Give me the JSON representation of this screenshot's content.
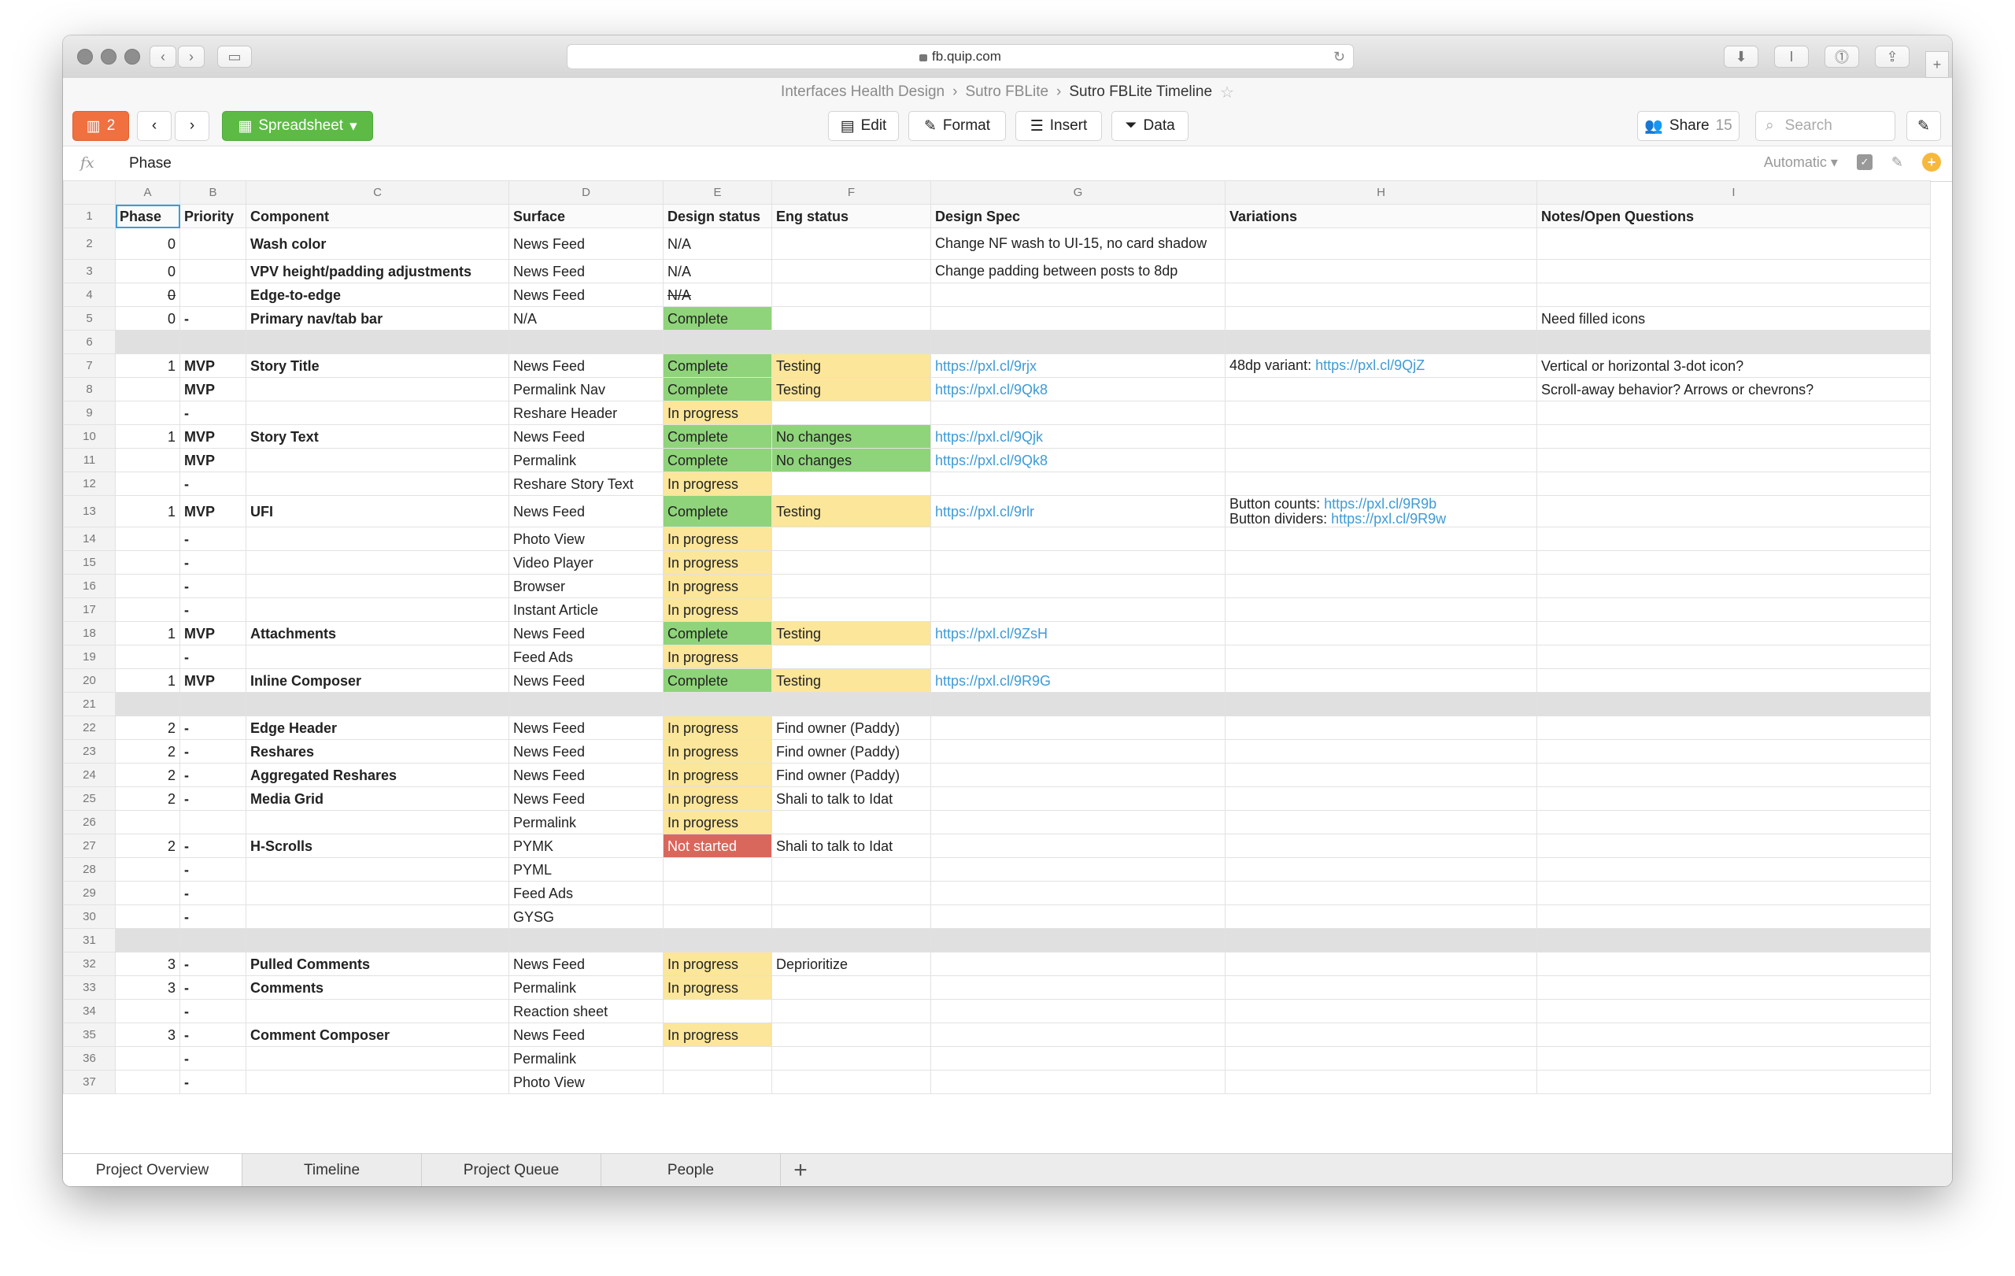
{
  "browser": {
    "url": "fb.quip.com"
  },
  "breadcrumb": {
    "items": [
      "Interfaces Health Design",
      "Sutro FBLite"
    ],
    "current": "Sutro FBLite Timeline"
  },
  "toolbar": {
    "sidebar_count": "2",
    "spreadsheet_label": "Spreadsheet",
    "edit_label": "Edit",
    "format_label": "Format",
    "insert_label": "Insert",
    "data_label": "Data",
    "share_label": "Share",
    "share_count": "15",
    "search_placeholder": "Search"
  },
  "formula_bar": {
    "fx": "fx",
    "value": "Phase",
    "format": "Automatic"
  },
  "columns": [
    "A",
    "B",
    "C",
    "D",
    "E",
    "F",
    "G",
    "H",
    "I"
  ],
  "header_row": [
    "Phase",
    "Priority",
    "Component",
    "Surface",
    "Design status",
    "Eng status",
    "Design Spec",
    "Variations",
    "Notes/Open Questions"
  ],
  "rows": [
    {
      "n": "2",
      "phase": "0",
      "priority": "",
      "component": "Wash color",
      "surface": "News Feed",
      "design": "N/A",
      "eng": "",
      "spec": "Change NF wash to UI-15, no card shadow",
      "var": "",
      "var_link": "",
      "var2": "",
      "var2_link": "",
      "notes": ""
    },
    {
      "n": "3",
      "phase": "0",
      "priority": "",
      "component": "VPV height/padding adjustments",
      "surface": "News Feed",
      "design": "N/A",
      "eng": "",
      "spec": "Change padding between posts to 8dp",
      "var": "",
      "var_link": "",
      "var2": "",
      "var2_link": "",
      "notes": ""
    },
    {
      "n": "4",
      "phase": "0",
      "priority": "",
      "component": "Edge-to-edge",
      "surface": "News Feed",
      "design": "N/A",
      "eng": "",
      "spec": "",
      "var": "",
      "var_link": "",
      "var2": "",
      "var2_link": "",
      "notes": ""
    },
    {
      "n": "5",
      "phase": "0",
      "priority": "-",
      "component": "Primary nav/tab bar",
      "surface": "N/A",
      "design": "Complete",
      "eng": "",
      "spec": "",
      "var": "",
      "var_link": "",
      "var2": "",
      "var2_link": "",
      "notes": "Need filled icons"
    },
    {
      "n": "6",
      "sep": true
    },
    {
      "n": "7",
      "phase": "1",
      "priority": "MVP",
      "component": "Story Title",
      "surface": "News Feed",
      "design": "Complete",
      "eng": "Testing",
      "spec": "https://pxl.cl/9rjx",
      "var": "48dp variant: ",
      "var_link": "https://pxl.cl/9QjZ",
      "var2": "",
      "var2_link": "",
      "notes": "Vertical or horizontal 3-dot icon?"
    },
    {
      "n": "8",
      "phase": "",
      "priority": "MVP",
      "component": "",
      "surface": "Permalink Nav",
      "design": "Complete",
      "eng": "Testing",
      "spec": "https://pxl.cl/9Qk8",
      "var": "",
      "var_link": "",
      "var2": "",
      "var2_link": "",
      "notes": "Scroll-away behavior? Arrows or chevrons?"
    },
    {
      "n": "9",
      "phase": "",
      "priority": "-",
      "component": "",
      "surface": "Reshare Header",
      "design": "In progress",
      "eng": "",
      "spec": "",
      "var": "",
      "var_link": "",
      "var2": "",
      "var2_link": "",
      "notes": ""
    },
    {
      "n": "10",
      "phase": "1",
      "priority": "MVP",
      "component": "Story Text",
      "surface": "News Feed",
      "design": "Complete",
      "eng": "No changes",
      "spec": "https://pxl.cl/9Qjk",
      "var": "",
      "var_link": "",
      "var2": "",
      "var2_link": "",
      "notes": ""
    },
    {
      "n": "11",
      "phase": "",
      "priority": "MVP",
      "component": "",
      "surface": "Permalink",
      "design": "Complete",
      "eng": "No changes",
      "spec": "https://pxl.cl/9Qk8",
      "var": "",
      "var_link": "",
      "var2": "",
      "var2_link": "",
      "notes": ""
    },
    {
      "n": "12",
      "phase": "",
      "priority": "-",
      "component": "",
      "surface": "Reshare Story Text",
      "design": "In progress",
      "eng": "",
      "spec": "",
      "var": "",
      "var_link": "",
      "var2": "",
      "var2_link": "",
      "notes": ""
    },
    {
      "n": "13",
      "phase": "1",
      "priority": "MVP",
      "component": "UFI",
      "surface": "News Feed",
      "design": "Complete",
      "eng": "Testing",
      "spec": "https://pxl.cl/9rlr",
      "var": "Button counts: ",
      "var_link": "https://pxl.cl/9R9b",
      "var2": "Button dividers: ",
      "var2_link": "https://pxl.cl/9R9w",
      "notes": ""
    },
    {
      "n": "14",
      "phase": "",
      "priority": "-",
      "component": "",
      "surface": "Photo View",
      "design": "In progress",
      "eng": "",
      "spec": "",
      "var": "",
      "var_link": "",
      "var2": "",
      "var2_link": "",
      "notes": ""
    },
    {
      "n": "15",
      "phase": "",
      "priority": "-",
      "component": "",
      "surface": "Video Player",
      "design": "In progress",
      "eng": "",
      "spec": "",
      "var": "",
      "var_link": "",
      "var2": "",
      "var2_link": "",
      "notes": ""
    },
    {
      "n": "16",
      "phase": "",
      "priority": "-",
      "component": "",
      "surface": "Browser",
      "design": "In progress",
      "eng": "",
      "spec": "",
      "var": "",
      "var_link": "",
      "var2": "",
      "var2_link": "",
      "notes": ""
    },
    {
      "n": "17",
      "phase": "",
      "priority": "-",
      "component": "",
      "surface": "Instant Article",
      "design": "In progress",
      "eng": "",
      "spec": "",
      "var": "",
      "var_link": "",
      "var2": "",
      "var2_link": "",
      "notes": ""
    },
    {
      "n": "18",
      "phase": "1",
      "priority": "MVP",
      "component": "Attachments",
      "surface": "News Feed",
      "design": "Complete",
      "eng": "Testing",
      "spec": "https://pxl.cl/9ZsH",
      "var": "",
      "var_link": "",
      "var2": "",
      "var2_link": "",
      "notes": ""
    },
    {
      "n": "19",
      "phase": "",
      "priority": "-",
      "component": "",
      "surface": "Feed Ads",
      "design": "In progress",
      "eng": "",
      "spec": "",
      "var": "",
      "var_link": "",
      "var2": "",
      "var2_link": "",
      "notes": ""
    },
    {
      "n": "20",
      "phase": "1",
      "priority": "MVP",
      "component": "Inline Composer",
      "surface": "News Feed",
      "design": "Complete",
      "eng": "Testing",
      "spec": "https://pxl.cl/9R9G",
      "var": "",
      "var_link": "",
      "var2": "",
      "var2_link": "",
      "notes": ""
    },
    {
      "n": "21",
      "sep": true
    },
    {
      "n": "22",
      "phase": "2",
      "priority": "-",
      "component": "Edge Header",
      "surface": "News Feed",
      "design": "In progress",
      "eng": "Find owner (Paddy)",
      "spec": "",
      "var": "",
      "var_link": "",
      "var2": "",
      "var2_link": "",
      "notes": ""
    },
    {
      "n": "23",
      "phase": "2",
      "priority": "-",
      "component": "Reshares",
      "surface": "News Feed",
      "design": "In progress",
      "eng": "Find owner (Paddy)",
      "spec": "",
      "var": "",
      "var_link": "",
      "var2": "",
      "var2_link": "",
      "notes": ""
    },
    {
      "n": "24",
      "phase": "2",
      "priority": "-",
      "component": "Aggregated Reshares",
      "surface": "News Feed",
      "design": "In progress",
      "eng": "Find owner (Paddy)",
      "spec": "",
      "var": "",
      "var_link": "",
      "var2": "",
      "var2_link": "",
      "notes": ""
    },
    {
      "n": "25",
      "phase": "2",
      "priority": "-",
      "component": "Media Grid",
      "surface": "News Feed",
      "design": "In progress",
      "eng": "Shali to talk to Idat",
      "spec": "",
      "var": "",
      "var_link": "",
      "var2": "",
      "var2_link": "",
      "notes": ""
    },
    {
      "n": "26",
      "phase": "",
      "priority": "",
      "component": "",
      "surface": "Permalink",
      "design": "In progress",
      "eng": "",
      "spec": "",
      "var": "",
      "var_link": "",
      "var2": "",
      "var2_link": "",
      "notes": ""
    },
    {
      "n": "27",
      "phase": "2",
      "priority": "-",
      "component": "H-Scrolls",
      "surface": "PYMK",
      "design": "Not started",
      "eng": "Shali to talk to Idat",
      "spec": "",
      "var": "",
      "var_link": "",
      "var2": "",
      "var2_link": "",
      "notes": ""
    },
    {
      "n": "28",
      "phase": "",
      "priority": "-",
      "component": "",
      "surface": "PYML",
      "design": "",
      "eng": "",
      "spec": "",
      "var": "",
      "var_link": "",
      "var2": "",
      "var2_link": "",
      "notes": ""
    },
    {
      "n": "29",
      "phase": "",
      "priority": "-",
      "component": "",
      "surface": "Feed Ads",
      "design": "",
      "eng": "",
      "spec": "",
      "var": "",
      "var_link": "",
      "var2": "",
      "var2_link": "",
      "notes": ""
    },
    {
      "n": "30",
      "phase": "",
      "priority": "-",
      "component": "",
      "surface": "GYSG",
      "design": "",
      "eng": "",
      "spec": "",
      "var": "",
      "var_link": "",
      "var2": "",
      "var2_link": "",
      "notes": ""
    },
    {
      "n": "31",
      "sep": true
    },
    {
      "n": "32",
      "phase": "3",
      "priority": "-",
      "component": "Pulled Comments",
      "surface": "News Feed",
      "design": "In progress",
      "eng": "Deprioritize",
      "spec": "",
      "var": "",
      "var_link": "",
      "var2": "",
      "var2_link": "",
      "notes": ""
    },
    {
      "n": "33",
      "phase": "3",
      "priority": "-",
      "component": "Comments",
      "surface": "Permalink",
      "design": "In progress",
      "eng": "",
      "spec": "",
      "var": "",
      "var_link": "",
      "var2": "",
      "var2_link": "",
      "notes": ""
    },
    {
      "n": "34",
      "phase": "",
      "priority": "-",
      "component": "",
      "surface": "Reaction sheet",
      "design": "",
      "eng": "",
      "spec": "",
      "var": "",
      "var_link": "",
      "var2": "",
      "var2_link": "",
      "notes": ""
    },
    {
      "n": "35",
      "phase": "3",
      "priority": "-",
      "component": "Comment Composer",
      "surface": "News Feed",
      "design": "In progress",
      "eng": "",
      "spec": "",
      "var": "",
      "var_link": "",
      "var2": "",
      "var2_link": "",
      "notes": ""
    },
    {
      "n": "36",
      "phase": "",
      "priority": "-",
      "component": "",
      "surface": "Permalink",
      "design": "",
      "eng": "",
      "spec": "",
      "var": "",
      "var_link": "",
      "var2": "",
      "var2_link": "",
      "notes": ""
    },
    {
      "n": "37",
      "phase": "",
      "priority": "-",
      "component": "",
      "surface": "Photo View",
      "design": "",
      "eng": "",
      "spec": "",
      "var": "",
      "var_link": "",
      "var2": "",
      "var2_link": "",
      "notes": ""
    }
  ],
  "sheet_tabs": [
    "Project Overview",
    "Timeline",
    "Project Queue",
    "People"
  ],
  "colors": {
    "complete": "#8fd47a",
    "in_progress": "#fbe69a",
    "not_started": "#d9675c",
    "link": "#3e9bd6",
    "spreadsheet_button": "#5dbb45",
    "sidebar_button": "#f07040"
  }
}
